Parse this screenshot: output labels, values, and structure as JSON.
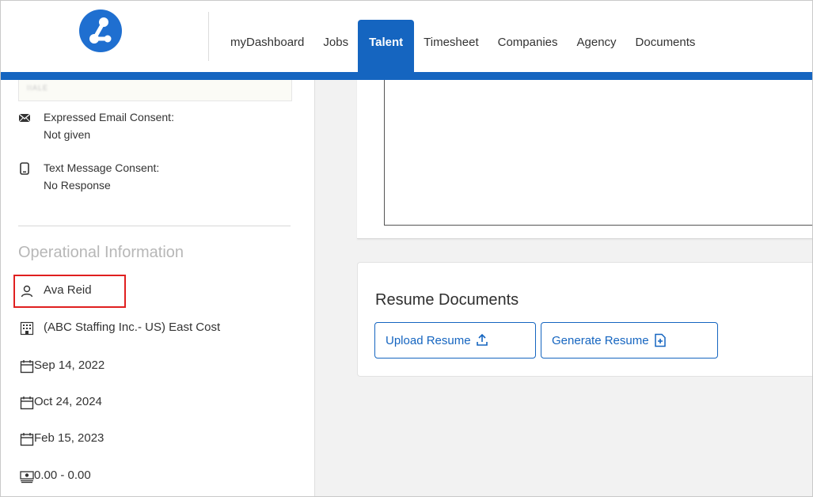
{
  "header": {
    "nav": [
      "myDashboard",
      "Jobs",
      "Talent",
      "Timesheet",
      "Companies",
      "Agency",
      "Documents"
    ],
    "active_tab": "Talent",
    "brand_color": "#1565c0"
  },
  "sidebar": {
    "redacted_box_text": "IIALE",
    "email_consent": {
      "label": "Expressed Email Consent:",
      "value": "Not given",
      "icon": "envelope-icon"
    },
    "text_consent": {
      "label": "Text Message Consent:",
      "value": "No Response",
      "icon": "mobile-phone-icon"
    },
    "section_title": "Operational Information",
    "operational": {
      "person": "Ava Reid",
      "agency": "(ABC Staffing Inc.- US) East Cost",
      "date1": "Sep 14, 2022",
      "date2": "Oct 24, 2024",
      "date3": "Feb 15, 2023",
      "pay_range": "0.00 - 0.00"
    }
  },
  "main": {
    "resume_title": "Resume Documents",
    "upload_button": "Upload Resume",
    "generate_button": "Generate Resume"
  },
  "colors": {
    "highlight": "#e02020",
    "accent": "#1565c0"
  }
}
